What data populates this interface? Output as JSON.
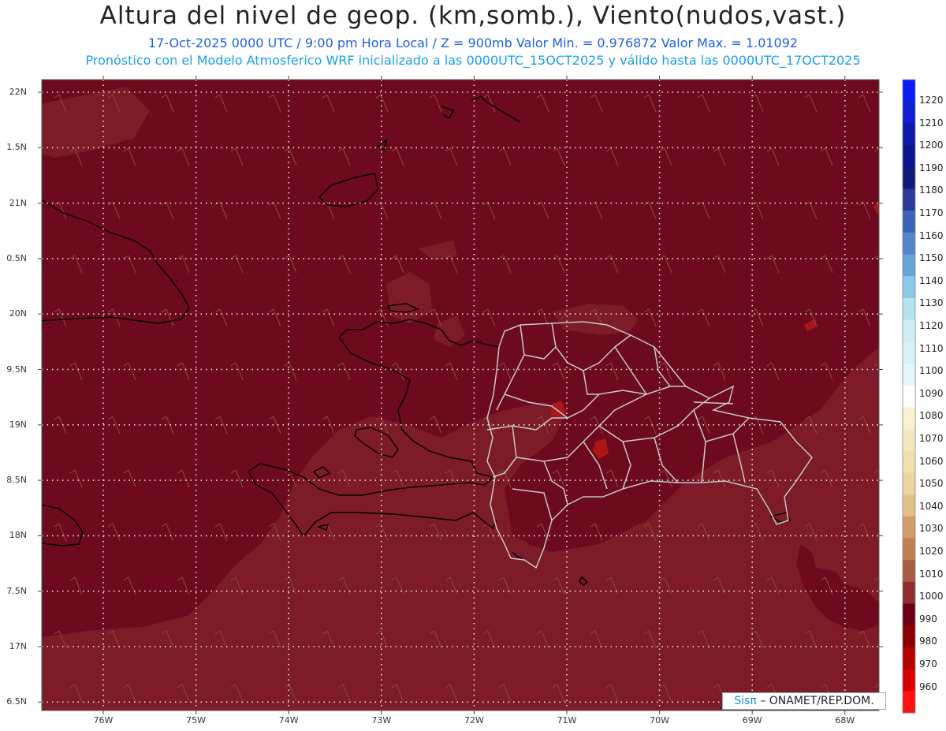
{
  "header": {
    "title": "Altura del nivel de geop. (km,somb.), Viento(nudos,vast.)",
    "subtitle1": "17-Oct-2025  0000 UTC / 9:00 pm Hora Local / Z = 900mb   Valor Min. = 0.976872  Valor Max. = 1.01092",
    "subtitle2": "Pronóstico con el Modelo Atmosferico WRF inicializado a las 0000UTC_15OCT2025 y válido hasta las  0000UTC_17OCT2025"
  },
  "axes": {
    "lat_labels": [
      "22N",
      "1.5N",
      "21N",
      "0.5N",
      "20N",
      "9.5N",
      "19N",
      "8.5N",
      "18N",
      "7.5N",
      "17N",
      "6.5N"
    ],
    "lon_labels": [
      "76W",
      "75W",
      "74W",
      "73W",
      "72W",
      "71W",
      "70W",
      "69W",
      "68W"
    ]
  },
  "colorbar": {
    "labels": [
      "1220",
      "1210",
      "1200",
      "1190",
      "1180",
      "1170",
      "1160",
      "1150",
      "1140",
      "1130",
      "1120",
      "1110",
      "1100",
      "1090",
      "1080",
      "1070",
      "1060",
      "1050",
      "1040",
      "1030",
      "1020",
      "1010",
      "1000",
      "990",
      "980",
      "970",
      "960"
    ],
    "colors": [
      "#0a1cf5",
      "#0f1ed0",
      "#0c1aa8",
      "#0a1690",
      "#101a78",
      "#2a3b9a",
      "#3d63b8",
      "#5584c8",
      "#6aa5d8",
      "#8ec8e8",
      "#b6e2f0",
      "#cdeef6",
      "#d6f2f8",
      "#e0f7fb",
      "#ffffff",
      "#fbf1d0",
      "#f6e8c0",
      "#f1dfb0",
      "#eed4a2",
      "#e2c08a",
      "#cf9e6a",
      "#c08055",
      "#a55e44",
      "#8f2f2f",
      "#6b0018",
      "#8a0000",
      "#b50000",
      "#d80000",
      "#ff1010"
    ]
  },
  "map": {
    "background_color": "#6d0a1d",
    "lighter_region_color": "#7e1b28",
    "wind_barb_color": "#8a4040",
    "grid_color": "#e8e8e8",
    "coast_color": "#000000",
    "province_color": "#c8c8c8"
  },
  "credit": {
    "sis": "Sisπ",
    "org": "– ONAMET/REP.DOM."
  }
}
